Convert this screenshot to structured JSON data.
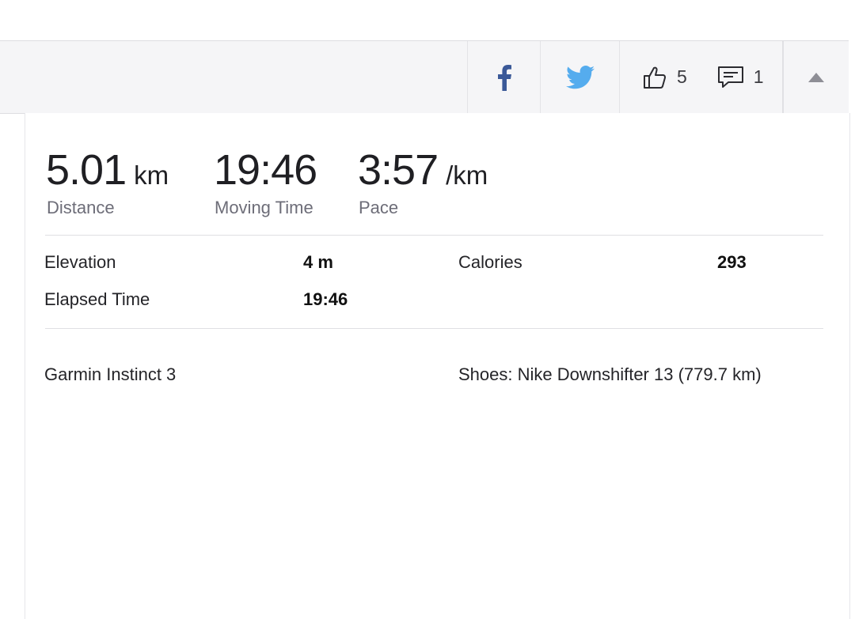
{
  "social": {
    "facebook_icon": "facebook-icon",
    "twitter_icon": "twitter-icon",
    "kudos_count": "5",
    "comment_count": "1",
    "colors": {
      "facebook": "#3b5998",
      "twitter": "#55acee"
    }
  },
  "stats": [
    {
      "value": "5.01",
      "unit": "km",
      "label": "Distance"
    },
    {
      "value": "19:46",
      "unit": "",
      "label": "Moving Time"
    },
    {
      "value": "3:57",
      "unit": "/km",
      "label": "Pace"
    }
  ],
  "details": {
    "elevation_label": "Elevation",
    "elevation_value": "4 m",
    "calories_label": "Calories",
    "calories_value": "293",
    "elapsed_label": "Elapsed Time",
    "elapsed_value": "19:46"
  },
  "gear": {
    "device": "Garmin Instinct 3",
    "shoes": "Shoes: Nike Downshifter 13 (779.7 km)"
  }
}
